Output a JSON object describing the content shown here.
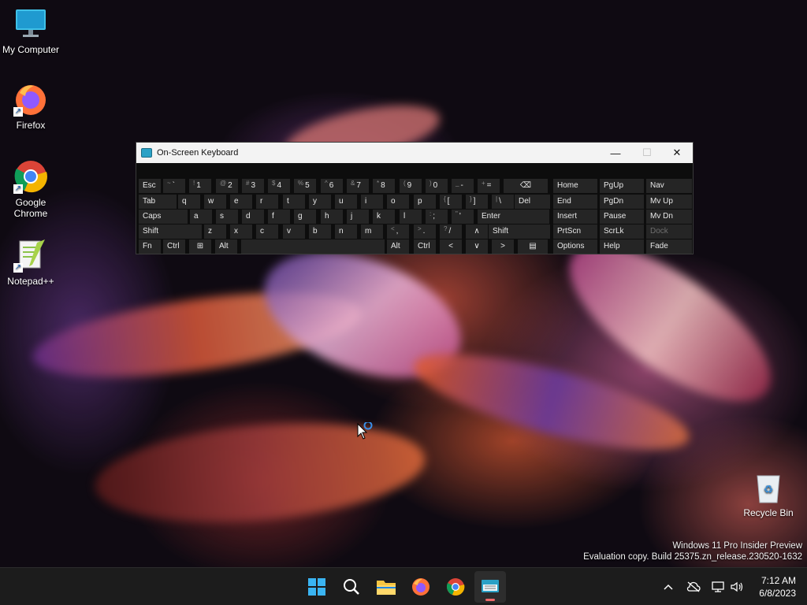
{
  "desktop": {
    "icons": [
      {
        "label": "My Computer"
      },
      {
        "label": "Firefox"
      },
      {
        "label": "Google Chrome"
      },
      {
        "label": "Notepad++"
      },
      {
        "label": "Recycle Bin"
      }
    ],
    "watermark": {
      "line1": "Windows 11 Pro Insider Preview",
      "line2": "Evaluation copy. Build 25375.zn_release.230520-1632"
    }
  },
  "osk": {
    "title": "On-Screen Keyboard",
    "rows": [
      [
        {
          "label": "Esc"
        },
        {
          "shift": "~",
          "label": "`"
        },
        {
          "shift": "!",
          "label": "1"
        },
        {
          "shift": "@",
          "label": "2"
        },
        {
          "shift": "#",
          "label": "3"
        },
        {
          "shift": "$",
          "label": "4"
        },
        {
          "shift": "%",
          "label": "5"
        },
        {
          "shift": "^",
          "label": "6"
        },
        {
          "shift": "&",
          "label": "7"
        },
        {
          "shift": "*",
          "label": "8"
        },
        {
          "shift": "(",
          "label": "9"
        },
        {
          "shift": ")",
          "label": "0"
        },
        {
          "shift": "_",
          "label": "-"
        },
        {
          "shift": "+",
          "label": "="
        },
        {
          "label": "⌫"
        }
      ],
      [
        {
          "label": "Tab"
        },
        {
          "label": "q"
        },
        {
          "label": "w"
        },
        {
          "label": "e"
        },
        {
          "label": "r"
        },
        {
          "label": "t"
        },
        {
          "label": "y"
        },
        {
          "label": "u"
        },
        {
          "label": "i"
        },
        {
          "label": "o"
        },
        {
          "label": "p"
        },
        {
          "shift": "{",
          "label": "["
        },
        {
          "shift": "}",
          "label": "]"
        },
        {
          "shift": "|",
          "label": "\\"
        },
        {
          "label": "Del"
        }
      ],
      [
        {
          "label": "Caps"
        },
        {
          "label": "a"
        },
        {
          "label": "s"
        },
        {
          "label": "d"
        },
        {
          "label": "f"
        },
        {
          "label": "g"
        },
        {
          "label": "h"
        },
        {
          "label": "j"
        },
        {
          "label": "k"
        },
        {
          "label": "l"
        },
        {
          "shift": ":",
          "label": ";"
        },
        {
          "shift": "\"",
          "label": "'"
        },
        {
          "label": "Enter"
        }
      ],
      [
        {
          "label": "Shift"
        },
        {
          "label": "z"
        },
        {
          "label": "x"
        },
        {
          "label": "c"
        },
        {
          "label": "v"
        },
        {
          "label": "b"
        },
        {
          "label": "n"
        },
        {
          "label": "m"
        },
        {
          "shift": "<",
          "label": ","
        },
        {
          "shift": ">",
          "label": "."
        },
        {
          "shift": "?",
          "label": "/"
        },
        {
          "label": "∧"
        },
        {
          "label": "Shift"
        }
      ],
      [
        {
          "label": "Fn"
        },
        {
          "label": "Ctrl"
        },
        {
          "label": "⊞"
        },
        {
          "label": "Alt"
        },
        {
          "label": ""
        },
        {
          "label": "Alt"
        },
        {
          "label": "Ctrl"
        },
        {
          "label": "<"
        },
        {
          "label": "∨"
        },
        {
          "label": ">"
        },
        {
          "label": "▤"
        }
      ]
    ],
    "nav_keys": [
      [
        "Home",
        "PgUp",
        "Nav"
      ],
      [
        "End",
        "PgDn",
        "Mv Up"
      ],
      [
        "Insert",
        "Pause",
        "Mv Dn"
      ],
      [
        "PrtScn",
        "ScrLk",
        "Dock"
      ],
      [
        "Options",
        "Help",
        "Fade"
      ]
    ]
  },
  "taskbar": {
    "apps": [
      {
        "icon": "windows-start-icon"
      },
      {
        "icon": "search-icon"
      },
      {
        "icon": "file-explorer-icon"
      },
      {
        "icon": "firefox-icon"
      },
      {
        "icon": "chrome-icon"
      },
      {
        "icon": "on-screen-keyboard-icon",
        "active": true
      }
    ],
    "clock": {
      "time": "7:12 AM",
      "date": "6/8/2023"
    }
  }
}
